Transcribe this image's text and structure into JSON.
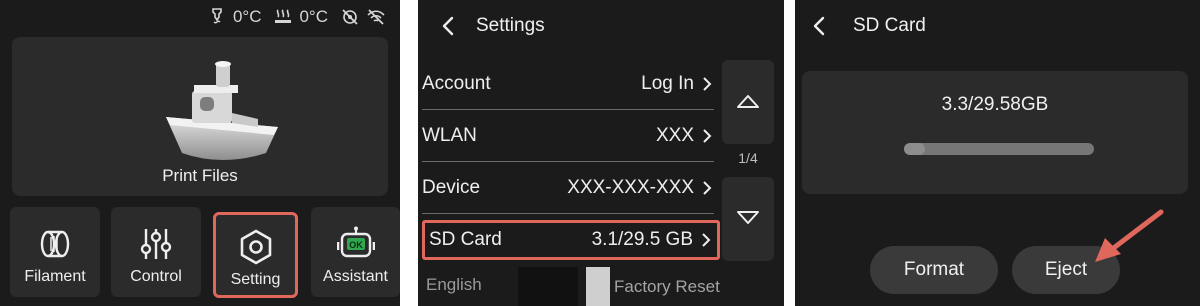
{
  "home": {
    "status": {
      "nozzle_temp": "0°C",
      "bed_temp": "0°C"
    },
    "print_files_label": "Print Files",
    "tiles": [
      {
        "label": "Filament",
        "icon": "filament-spool-icon"
      },
      {
        "label": "Control",
        "icon": "sliders-icon"
      },
      {
        "label": "Setting",
        "icon": "hexagon-gear-icon"
      },
      {
        "label": "Assistant",
        "icon": "robot-ok-icon"
      }
    ]
  },
  "settings": {
    "title": "Settings",
    "rows": [
      {
        "label": "Account",
        "value": "Log In"
      },
      {
        "label": "WLAN",
        "value": "XXX"
      },
      {
        "label": "Device",
        "value": "XXX-XXX-XXX"
      },
      {
        "label": "SD Card",
        "value": "3.1/29.5 GB"
      }
    ],
    "page_indicator": "1/4",
    "language": "English",
    "factory_reset": "Factory Reset"
  },
  "sd_card": {
    "title": "SD Card",
    "usage": "3.3/29.58GB",
    "used_fraction": 0.11,
    "format_label": "Format",
    "eject_label": "Eject"
  },
  "colors": {
    "highlight": "#e0675c",
    "panel_bg": "#1b1b1b",
    "card_bg": "#2b2b2b"
  }
}
